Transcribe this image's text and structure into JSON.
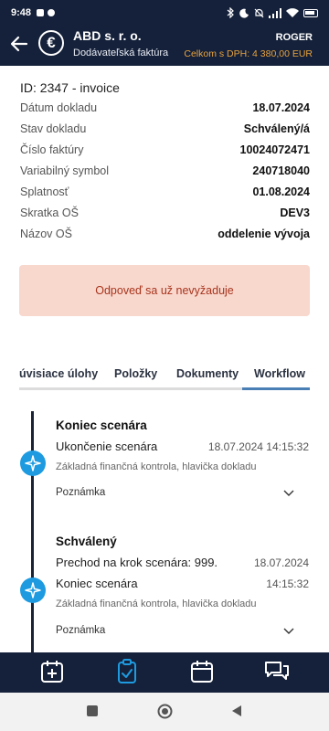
{
  "status_bar": {
    "time": "9:48"
  },
  "header": {
    "company": "ABD s. r. o.",
    "document_type": "Dodávateľská faktúra",
    "user": "ROGER",
    "total": "Celkom s DPH: 4 380,00 EUR"
  },
  "document": {
    "id": "ID: 2347 - invoice",
    "fields": [
      {
        "label": "Dátum dokladu",
        "value": "18.07.2024"
      },
      {
        "label": "Stav dokladu",
        "value": "Schválený/á"
      },
      {
        "label": "Číslo faktúry",
        "value": "10024072471"
      },
      {
        "label": "Variabilný symbol",
        "value": "240718040"
      },
      {
        "label": "Splatnosť",
        "value": "01.08.2024"
      },
      {
        "label": "Skratka OŠ",
        "value": "DEV3"
      },
      {
        "label": "Názov OŠ",
        "value": "oddelenie vývoja"
      }
    ]
  },
  "notice": "Odpoveď sa už nevyžaduje",
  "tabs": [
    {
      "label": "úvisiace úlohy"
    },
    {
      "label": "Položky"
    },
    {
      "label": "Dokumenty"
    },
    {
      "label": "Workflow",
      "active": true
    }
  ],
  "workflow": [
    {
      "title": "Koniec scenára",
      "lines": [
        {
          "text": "Ukončenie scenára",
          "date": "18.07.2024 14:15:32"
        }
      ],
      "sub": "Základná finančná kontrola, hlavička dokladu",
      "note_label": "Poznámka"
    },
    {
      "title": "Schválený",
      "lines": [
        {
          "text": "Prechod na krok scenára: 999.",
          "date": "18.07.2024"
        },
        {
          "text": "Koniec scenára",
          "date": "14:15:32"
        }
      ],
      "sub": "Základná finančná kontrola, hlavička dokladu",
      "note_label": "Poznámka"
    }
  ],
  "bottom_nav": [
    {
      "icon": "calendar-add-icon"
    },
    {
      "icon": "clipboard-check-icon",
      "active": true
    },
    {
      "icon": "calendar-icon"
    },
    {
      "icon": "chat-icon"
    }
  ],
  "colors": {
    "header_bg": "#15213a",
    "accent": "#1e9be0",
    "total_text": "#e8a33c",
    "notice_bg": "#f8d7cd",
    "notice_text": "#a8351d",
    "tab_active": "#4a7fb5"
  }
}
